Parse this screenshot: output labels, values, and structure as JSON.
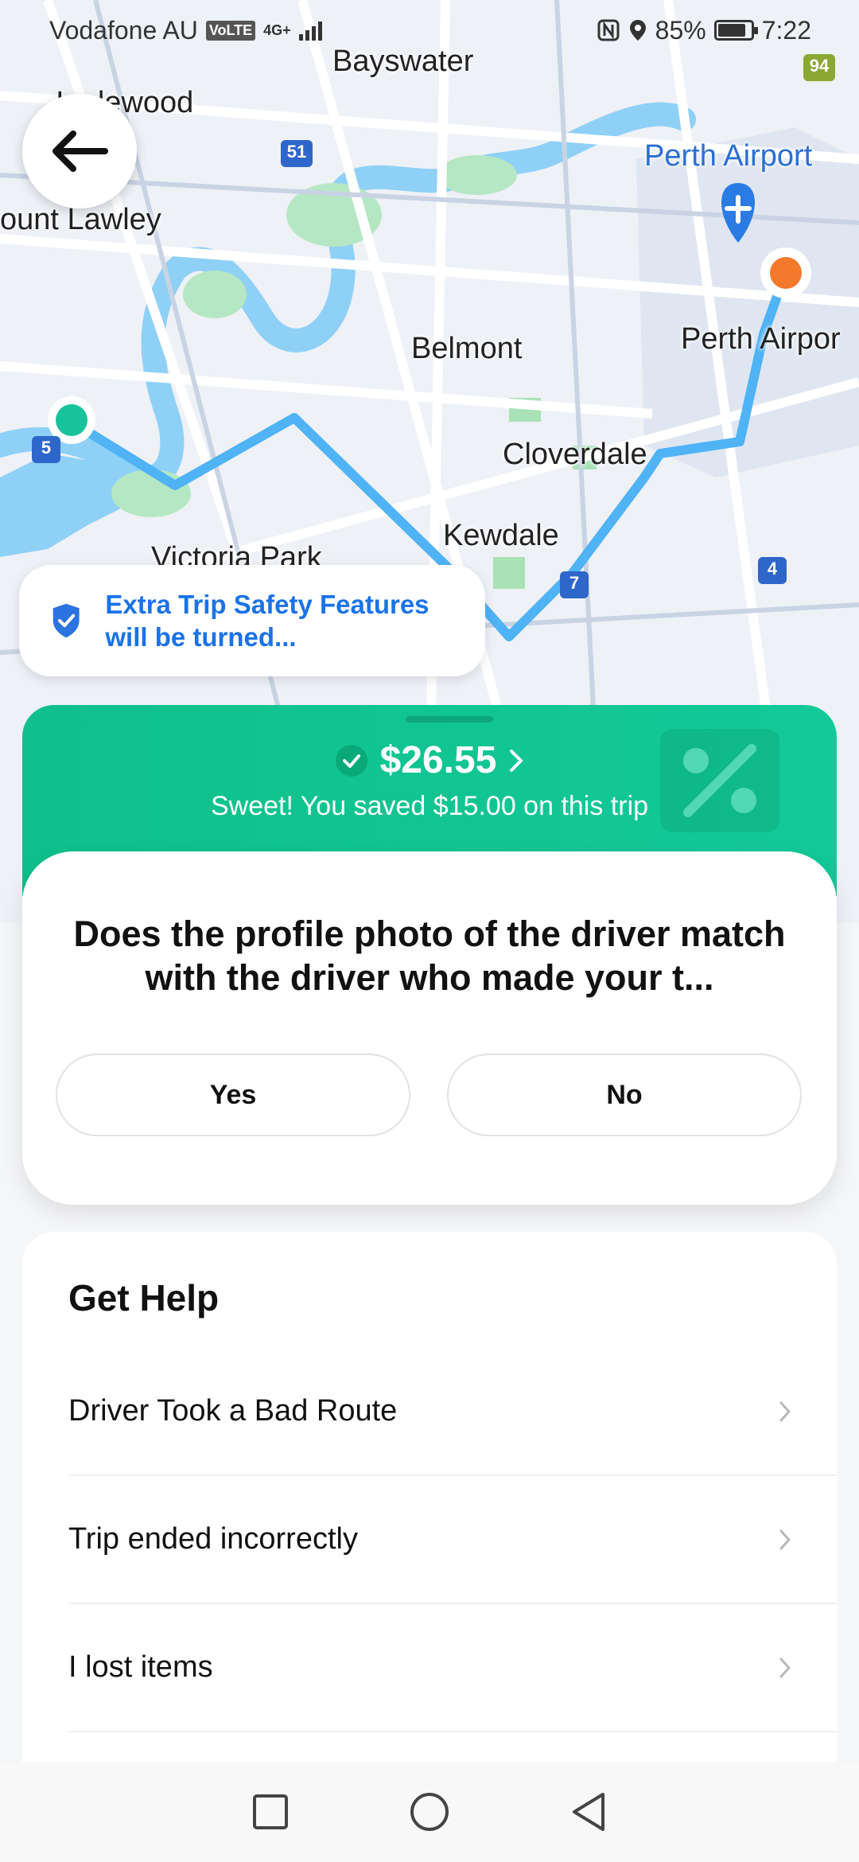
{
  "status_bar": {
    "carrier": "Vodafone AU",
    "volte": "VoLTE",
    "network": "4G+",
    "battery_percent": "85%",
    "battery_level": 0.85,
    "time": "7:22"
  },
  "map": {
    "labels": {
      "bayswater": "Bayswater",
      "inglewood": "Inglewood",
      "mount_lawley": "ount Lawley",
      "perth_airport_top": "Perth Airport",
      "perth_airport_right": "Perth Airpor",
      "belmont": "Belmont",
      "cloverdale": "Cloverdale",
      "kewdale": "Kewdale",
      "victoria_park": "Victoria Park"
    },
    "road_shields": [
      "51",
      "5",
      "7",
      "4",
      "94"
    ],
    "route_color": "#4fb3f6",
    "origin_color": "#17c39a",
    "destination_color": "#f5792a"
  },
  "safety_toast": {
    "text": "Extra Trip Safety Features will be turned...",
    "icon": "shield-check-icon"
  },
  "fare": {
    "amount": "$26.55",
    "saved_text": "Sweet! You saved $15.00 on this trip",
    "accent": "#10c48f"
  },
  "question": {
    "text": "Does the profile photo of the driver match with the driver who made your t...",
    "yes_label": "Yes",
    "no_label": "No"
  },
  "help": {
    "title": "Get Help",
    "items": [
      {
        "label": "Driver Took a Bad Route"
      },
      {
        "label": "Trip ended incorrectly"
      },
      {
        "label": "I lost items"
      }
    ]
  },
  "nav_bar": {
    "icons": [
      "recent-apps-icon",
      "home-icon",
      "back-nav-icon"
    ]
  }
}
